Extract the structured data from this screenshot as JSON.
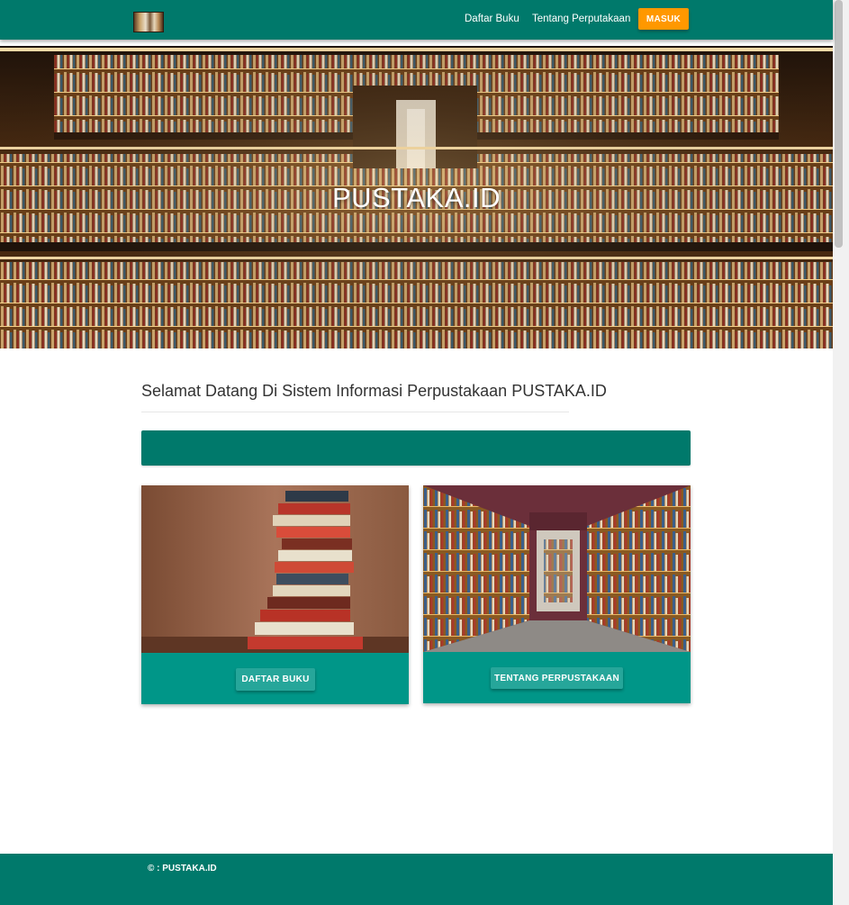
{
  "navbar": {
    "logo_icon": "library-logo-icon",
    "links": [
      "Daftar Buku",
      "Tentang Perputakaan"
    ],
    "login_label": "MASUK"
  },
  "hero": {
    "title": "PUSTAKA.ID"
  },
  "main": {
    "welcome": "Selamat Datang Di Sistem Informasi Perpustakaan PUSTAKA.ID",
    "cards": [
      {
        "image": "stacked-books-image",
        "button_label": "DAFTAR BUKU"
      },
      {
        "image": "library-aisle-image",
        "button_label": "TENTANG PERPUSTAKAAN"
      }
    ]
  },
  "footer": {
    "text": "© : PUSTAKA.ID"
  },
  "colors": {
    "primary": "#00796b",
    "card": "#009688",
    "button": "#26a69a",
    "accent": "#ff9800"
  }
}
